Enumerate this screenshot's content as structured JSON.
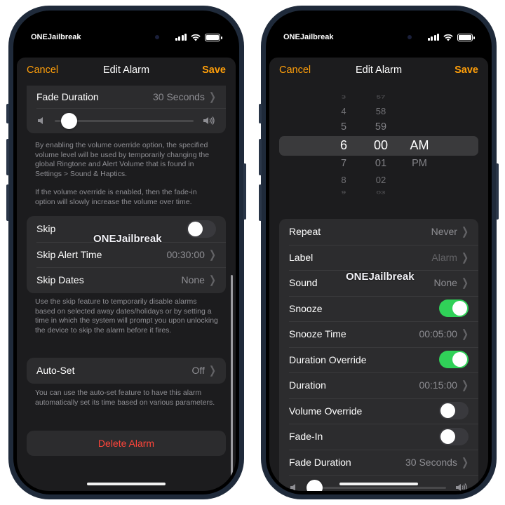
{
  "status_bar": {
    "carrier": "ONEJailbreak"
  },
  "nav": {
    "cancel": "Cancel",
    "title": "Edit Alarm",
    "save": "Save"
  },
  "watermark": "ONEJailbreak",
  "left_screen": {
    "fade_duration": {
      "label": "Fade Duration",
      "value": "30 Seconds"
    },
    "volume_slider_level": 0.1,
    "volume_note_1": "By enabling the volume override option, the specified volume level will be used by temporarily changing the global Ringtone and Alert Volume that is found in Settings > Sound & Haptics.",
    "volume_note_2": "If the volume override is enabled, then the fade-in option will slowly increase the volume over time.",
    "skip": {
      "label": "Skip",
      "on": false
    },
    "skip_alert_time": {
      "label": "Skip Alert Time",
      "value": "00:30:00"
    },
    "skip_dates": {
      "label": "Skip Dates",
      "value": "None"
    },
    "skip_note": "Use the skip feature to temporarily disable alarms based on selected away dates/holidays or by setting a time in which the system will prompt you upon unlocking the device to skip the alarm before it fires.",
    "auto_set": {
      "label": "Auto-Set",
      "value": "Off"
    },
    "auto_set_note": "You can use the auto-set feature to have this alarm automatically set its time based on various parameters.",
    "delete_label": "Delete Alarm"
  },
  "right_screen": {
    "picker": {
      "hours": [
        "3",
        "4",
        "5",
        "6",
        "7",
        "8",
        "9"
      ],
      "minutes": [
        "57",
        "58",
        "59",
        "00",
        "01",
        "02",
        "03"
      ],
      "periods": [
        "AM",
        "PM"
      ],
      "selected_hour": "6",
      "selected_minute": "00",
      "selected_period": "AM"
    },
    "repeat": {
      "label": "Repeat",
      "value": "Never"
    },
    "label_row": {
      "label": "Label",
      "value": "Alarm"
    },
    "sound": {
      "label": "Sound",
      "value": "None"
    },
    "snooze": {
      "label": "Snooze",
      "on": true
    },
    "snooze_time": {
      "label": "Snooze Time",
      "value": "00:05:00"
    },
    "duration_override": {
      "label": "Duration Override",
      "on": true
    },
    "duration": {
      "label": "Duration",
      "value": "00:15:00"
    },
    "volume_override": {
      "label": "Volume Override",
      "on": false
    },
    "fade_in": {
      "label": "Fade-In",
      "on": false
    },
    "fade_duration": {
      "label": "Fade Duration",
      "value": "30 Seconds"
    },
    "volume_slider_level": 0.05
  },
  "icons": {
    "speaker_low": "speaker-low-icon",
    "speaker_high": "speaker-high-icon",
    "chevron": "chevron-right-icon",
    "wifi": "wifi-icon",
    "signal": "signal-icon",
    "battery": "battery-icon"
  },
  "colors": {
    "accent": "#ff9f0a",
    "toggle_on": "#30d158",
    "destructive": "#ff453a"
  }
}
